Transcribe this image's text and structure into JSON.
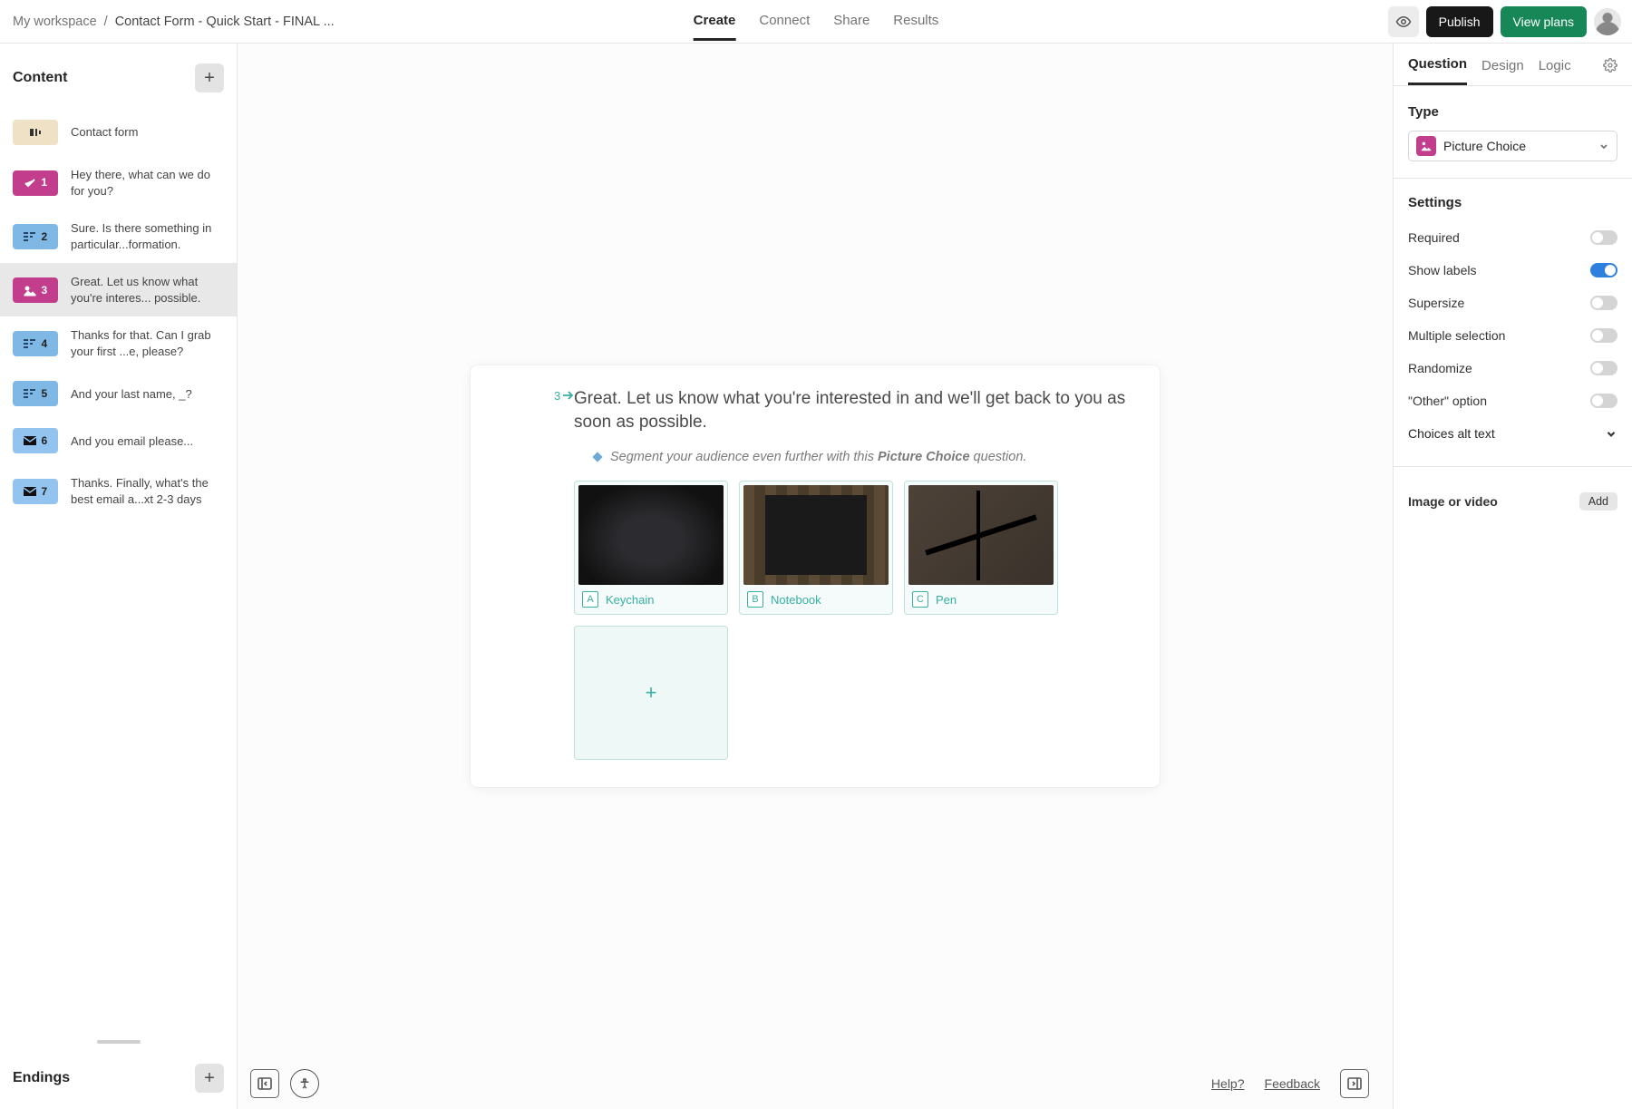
{
  "header": {
    "workspace": "My workspace",
    "title": "Contact Form - Quick Start - FINAL ...",
    "nav": {
      "create": "Create",
      "connect": "Connect",
      "share": "Share",
      "results": "Results"
    },
    "publish": "Publish",
    "plans": "View plans"
  },
  "sidebar": {
    "content_heading": "Content",
    "endings_heading": "Endings",
    "items": [
      {
        "kind": "welcome",
        "num": "",
        "label": "Contact form"
      },
      {
        "kind": "pink",
        "num": "1",
        "label": "Hey there, what can we do for you?"
      },
      {
        "kind": "blue",
        "num": "2",
        "label": "Sure. Is there something in particular...formation."
      },
      {
        "kind": "pink",
        "num": "3",
        "label": "Great. Let us know what you're interes... possible.",
        "selected": true
      },
      {
        "kind": "blue",
        "num": "4",
        "label": "Thanks for that. Can I grab your first ...e, please?"
      },
      {
        "kind": "blue",
        "num": "5",
        "label": "And your last name, _?"
      },
      {
        "kind": "bluedk",
        "num": "6",
        "label": "And you email please..."
      },
      {
        "kind": "bluedk",
        "num": "7",
        "label": "Thanks. Finally, what's the best email a...xt 2-3 days"
      }
    ]
  },
  "canvas": {
    "index": "3",
    "question": "Great. Let us know what you're interested in and we'll get back to you as soon as possible.",
    "description_prefix": "Segment your audience even further with this ",
    "description_bold": "Picture Choice",
    "description_suffix": " question.",
    "choices": [
      {
        "key": "A",
        "label": "Keychain"
      },
      {
        "key": "B",
        "label": "Notebook"
      },
      {
        "key": "C",
        "label": "Pen"
      }
    ],
    "footer": {
      "help": "Help?",
      "feedback": "Feedback"
    }
  },
  "panel": {
    "tabs": {
      "question": "Question",
      "design": "Design",
      "logic": "Logic"
    },
    "type_heading": "Type",
    "type_value": "Picture Choice",
    "settings_heading": "Settings",
    "settings": {
      "required": {
        "label": "Required",
        "on": false
      },
      "showlabels": {
        "label": "Show labels",
        "on": true
      },
      "supersize": {
        "label": "Supersize",
        "on": false
      },
      "multiple": {
        "label": "Multiple selection",
        "on": false
      },
      "randomize": {
        "label": "Randomize",
        "on": false
      },
      "other": {
        "label": "\"Other\" option",
        "on": false
      }
    },
    "alt_text": "Choices alt text",
    "media_heading": "Image or video",
    "add_label": "Add"
  }
}
